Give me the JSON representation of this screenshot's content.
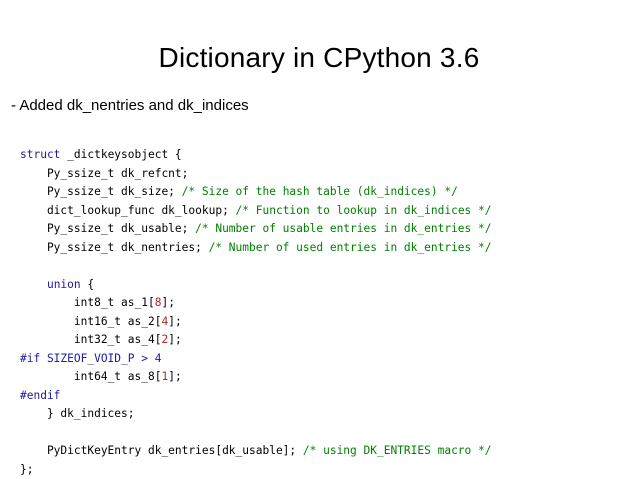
{
  "slide": {
    "title": "Dictionary in CPython 3.6",
    "subtitle": "-  Added dk_nentries and dk_indices"
  },
  "code": {
    "lines": [
      [
        {
          "t": "struct",
          "c": "kw"
        },
        {
          "t": " _dictkeysobject {",
          "c": ""
        }
      ],
      [
        {
          "t": "    Py_ssize_t dk_refcnt;",
          "c": ""
        }
      ],
      [
        {
          "t": "    Py_ssize_t dk_size; ",
          "c": ""
        },
        {
          "t": "/* Size of the hash table (dk_indices) */",
          "c": "cmt"
        }
      ],
      [
        {
          "t": "    dict_lookup_func dk_lookup; ",
          "c": ""
        },
        {
          "t": "/* Function to lookup in dk_indices */",
          "c": "cmt"
        }
      ],
      [
        {
          "t": "    Py_ssize_t dk_usable; ",
          "c": ""
        },
        {
          "t": "/* Number of usable entries in dk_entries */",
          "c": "cmt"
        }
      ],
      [
        {
          "t": "    Py_ssize_t dk_nentries; ",
          "c": ""
        },
        {
          "t": "/* Number of used entries in dk_entries */",
          "c": "cmt"
        }
      ],
      [
        {
          "t": "",
          "c": ""
        }
      ],
      [
        {
          "t": "    ",
          "c": ""
        },
        {
          "t": "union",
          "c": "kw"
        },
        {
          "t": " {",
          "c": ""
        }
      ],
      [
        {
          "t": "        int8_t as_1[",
          "c": ""
        },
        {
          "t": "8",
          "c": "num"
        },
        {
          "t": "];",
          "c": ""
        }
      ],
      [
        {
          "t": "        int16_t as_2[",
          "c": ""
        },
        {
          "t": "4",
          "c": "num"
        },
        {
          "t": "];",
          "c": ""
        }
      ],
      [
        {
          "t": "        int32_t as_4[",
          "c": ""
        },
        {
          "t": "2",
          "c": "num"
        },
        {
          "t": "];",
          "c": ""
        }
      ],
      [
        {
          "t": "#if SIZEOF_VOID_P > 4",
          "c": "pp"
        }
      ],
      [
        {
          "t": "        int64_t as_8[",
          "c": ""
        },
        {
          "t": "1",
          "c": "num"
        },
        {
          "t": "];",
          "c": ""
        }
      ],
      [
        {
          "t": "#endif",
          "c": "pp"
        }
      ],
      [
        {
          "t": "    } dk_indices;",
          "c": ""
        }
      ],
      [
        {
          "t": "",
          "c": ""
        }
      ],
      [
        {
          "t": "    PyDictKeyEntry dk_entries[dk_usable]; ",
          "c": ""
        },
        {
          "t": "/* using DK_ENTRIES macro */",
          "c": "cmt"
        }
      ],
      [
        {
          "t": "};",
          "c": ""
        }
      ]
    ]
  }
}
